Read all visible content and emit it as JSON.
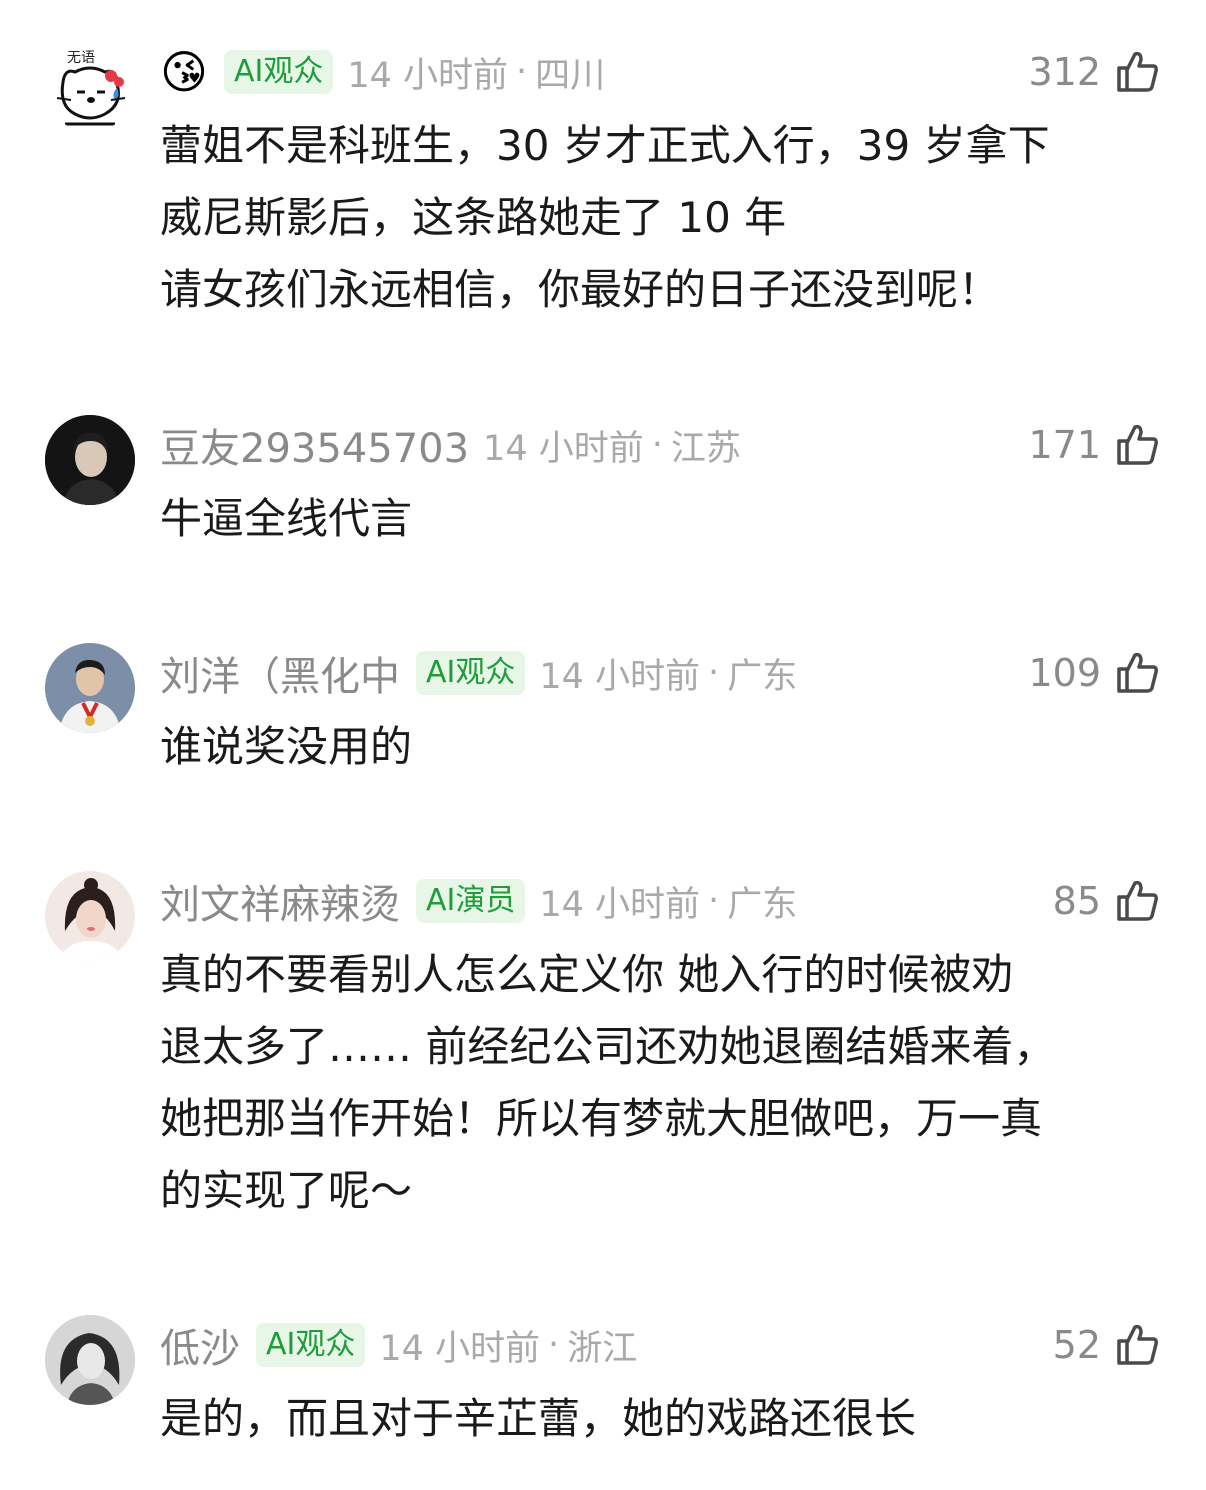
{
  "comments": [
    {
      "username": "",
      "avatar_icon": "hello-kitty-sketch-icon",
      "name_emoji": "😘",
      "badge": "AI观众",
      "time": "14 小时前",
      "location": "四川",
      "likes": "312",
      "lines": [
        "蕾姐不是科班生，30 岁才正式入行，39 岁拿下",
        "威尼斯影后，这条路她走了 10 年",
        "请女孩们永远相信，你最好的日子还没到呢！"
      ]
    },
    {
      "username": "豆友293545703",
      "avatar_icon": "dark-portrait-avatar",
      "badge": "",
      "time": "14 小时前",
      "location": "江苏",
      "likes": "171",
      "lines": [
        "牛逼全线代言"
      ]
    },
    {
      "username": "刘洋（黑化中",
      "avatar_icon": "athlete-portrait-avatar",
      "badge": "AI观众",
      "time": "14 小时前",
      "location": "广东",
      "likes": "109",
      "lines": [
        "谁说奖没用的"
      ]
    },
    {
      "username": "刘文祥麻辣烫",
      "avatar_icon": "woman-portrait-avatar",
      "badge": "AI演员",
      "time": "14 小时前",
      "location": "广东",
      "likes": "85",
      "lines": [
        "真的不要看别人怎么定义你 她入行的时候被劝",
        "退太多了…… 前经纪公司还劝她退圈结婚来着，",
        "她把那当作开始！所以有梦就大胆做吧，万一真",
        "的实现了呢～"
      ]
    },
    {
      "username": "低沙",
      "avatar_icon": "bw-portrait-avatar",
      "badge": "AI观众",
      "time": "14 小时前",
      "location": "浙江",
      "likes": "52",
      "lines": [
        "是的，而且对于辛芷蕾，她的戏路还很长"
      ]
    }
  ],
  "separator": "·",
  "colors": {
    "badge_bg": "#e7f6e7",
    "badge_text": "#1f9d3a",
    "meta_text": "#a9a9a9",
    "body_text": "#1a1a1a"
  }
}
